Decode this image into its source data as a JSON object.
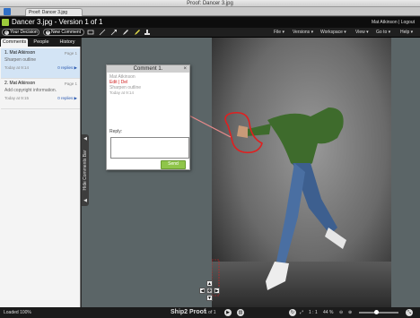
{
  "window": {
    "title": "Proof: Dancer 3.jpg"
  },
  "browser": {
    "tab_label": "Proof: Dancer 3.jpg"
  },
  "header": {
    "title": "Dancer 3.jpg - Version 1 of 1",
    "user": "Mat Atkinson",
    "separator": "|",
    "logout": "Logout"
  },
  "toolbar": {
    "your_decision": "Your Decision",
    "new_comment": "New Comment",
    "tools": [
      "square-tool-icon",
      "line-tool-icon",
      "arrow-tool-icon",
      "pen-tool-icon",
      "highlighter-tool-icon",
      "stamp-tool-icon"
    ],
    "menus": [
      "File ▾",
      "Versions ▾",
      "Workspace ▾",
      "View ▾",
      "Go to ▾",
      "Help ▾"
    ]
  },
  "sidebar": {
    "tabs": [
      "Comments",
      "People",
      "History"
    ],
    "active_tab": 0,
    "comments": [
      {
        "name": "1. Mat Atkinson",
        "page": "Page 1",
        "text": "Sharpen outline",
        "time": "Today  at  9:14",
        "replies": "0 replies ▶"
      },
      {
        "name": "2. Mat Atkinson",
        "page": "Page 1",
        "text": "Add copyright information.",
        "time": "Today  at  9:15",
        "replies": "0 replies ▶"
      }
    ],
    "hide_bar": "Hide Comments Bar"
  },
  "popup": {
    "title": "Comment 1.",
    "close": "×",
    "author": "Mat Atkinson",
    "actions": "Edit  |  Del",
    "text": "Sharpen outline",
    "time": "Today  at  9:14",
    "reply_label": "Reply:",
    "send": "Send"
  },
  "status": {
    "loaded": "Loaded 100%",
    "brand": "Ship2 Proof",
    "page": "1 of 1",
    "zoom_reset": "1 : 1",
    "zoom": "44 %",
    "zoom_fraction": 0.44
  },
  "colors": {
    "accent_green": "#8fc54a",
    "annotation_red": "#e02020",
    "selected_row": "#d3e4f5"
  }
}
